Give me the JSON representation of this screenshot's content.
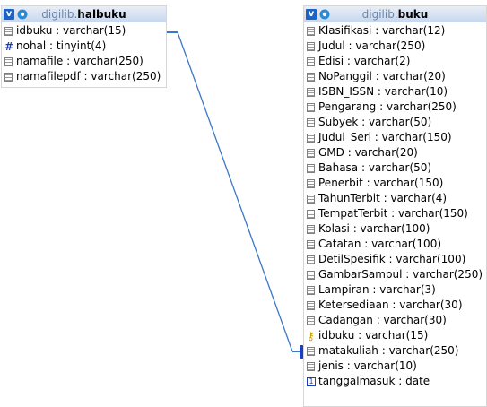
{
  "tables": {
    "halbuku": {
      "schema": "digilib",
      "name": "halbuku",
      "columns": [
        {
          "label": "idbuku : varchar(15)",
          "icon": "column-icon"
        },
        {
          "label": "nohal : tinyint(4)",
          "icon": "numeric-icon"
        },
        {
          "label": "namafile : varchar(250)",
          "icon": "column-icon"
        },
        {
          "label": "namafilepdf : varchar(250)",
          "icon": "column-icon"
        }
      ]
    },
    "buku": {
      "schema": "digilib",
      "name": "buku",
      "columns": [
        {
          "label": "Klasifikasi : varchar(12)",
          "icon": "column-icon"
        },
        {
          "label": "Judul : varchar(250)",
          "icon": "column-icon"
        },
        {
          "label": "Edisi : varchar(2)",
          "icon": "column-icon"
        },
        {
          "label": "NoPanggil : varchar(20)",
          "icon": "column-icon"
        },
        {
          "label": "ISBN_ISSN : varchar(10)",
          "icon": "column-icon"
        },
        {
          "label": "Pengarang : varchar(250)",
          "icon": "column-icon"
        },
        {
          "label": "Subyek : varchar(50)",
          "icon": "column-icon"
        },
        {
          "label": "Judul_Seri : varchar(150)",
          "icon": "column-icon"
        },
        {
          "label": "GMD : varchar(20)",
          "icon": "column-icon"
        },
        {
          "label": "Bahasa : varchar(50)",
          "icon": "column-icon"
        },
        {
          "label": "Penerbit : varchar(150)",
          "icon": "column-icon"
        },
        {
          "label": "TahunTerbit : varchar(4)",
          "icon": "column-icon"
        },
        {
          "label": "TempatTerbit : varchar(150)",
          "icon": "column-icon"
        },
        {
          "label": "Kolasi : varchar(100)",
          "icon": "column-icon"
        },
        {
          "label": "Catatan : varchar(100)",
          "icon": "column-icon"
        },
        {
          "label": "DetilSpesifik : varchar(100)",
          "icon": "column-icon"
        },
        {
          "label": "GambarSampul : varchar(250)",
          "icon": "column-icon"
        },
        {
          "label": "Lampiran : varchar(3)",
          "icon": "column-icon"
        },
        {
          "label": "Ketersediaan : varchar(30)",
          "icon": "column-icon"
        },
        {
          "label": "Cadangan : varchar(30)",
          "icon": "column-icon"
        },
        {
          "label": "idbuku : varchar(15)",
          "icon": "key-icon"
        },
        {
          "label": "matakuliah : varchar(250)",
          "icon": "column-icon"
        },
        {
          "label": "jenis : varchar(10)",
          "icon": "column-icon"
        },
        {
          "label": "tanggalmasuk : date",
          "icon": "date-icon"
        }
      ]
    }
  },
  "header_icons": {
    "v_label": "v",
    "v_icon": "v-icon",
    "settings_icon": "gear-icon"
  },
  "colors": {
    "header_bg": "#c9d8ee",
    "relation_line": "#3a78c6",
    "schema_text": "#6b86ad"
  }
}
